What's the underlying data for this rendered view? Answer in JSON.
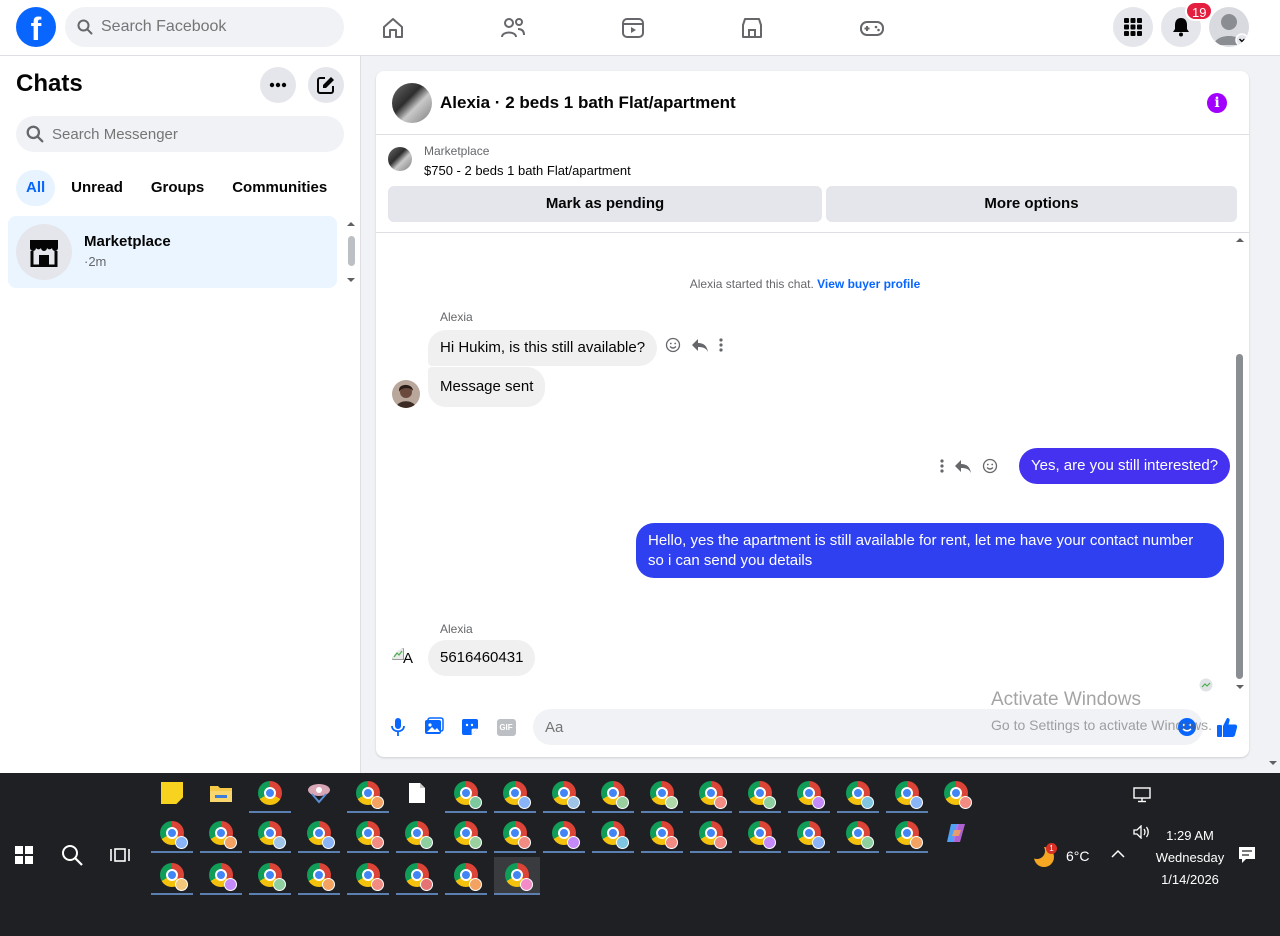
{
  "topbar": {
    "logo_letter": "f",
    "search_placeholder": "Search Facebook",
    "notifications_count": "19"
  },
  "sidebar": {
    "title": "Chats",
    "search_placeholder": "Search Messenger",
    "tabs": [
      "All",
      "Unread",
      "Groups",
      "Communities"
    ],
    "chat": {
      "name": "Marketplace",
      "time": "·2m"
    }
  },
  "conversation": {
    "title": "Alexia · 2 beds 1 bath Flat/apartment",
    "marketplace_label": "Marketplace",
    "listing": "$750 - 2 beds 1 bath Flat/apartment",
    "mark_pending": "Mark as pending",
    "more_options": "More options",
    "system_text": "Alexia started this chat.",
    "system_link": "View buyer profile",
    "messages": [
      {
        "sender": "Alexia",
        "text": "Hi Hukim, is this still available?"
      },
      {
        "sender": "",
        "text": "Message sent"
      },
      {
        "sender": "me",
        "text": "Yes, are you still interested?"
      },
      {
        "sender": "me",
        "text": "Hello, yes the apartment is still available for rent, let me have your contact number so i can send you details"
      },
      {
        "sender": "Alexia",
        "text": "5616460431"
      }
    ],
    "broken_avatar_alt": "A",
    "composer_placeholder": "Aa",
    "gif_label": "GIF"
  },
  "watermark": {
    "line1": "Activate Windows",
    "line2": "Go to Settings to activate Windows."
  },
  "taskbar": {
    "weather_temp": "6°C",
    "time": "1:29 AM",
    "day": "Wednesday",
    "date": "1/14/2026",
    "weather_badge": "1"
  }
}
